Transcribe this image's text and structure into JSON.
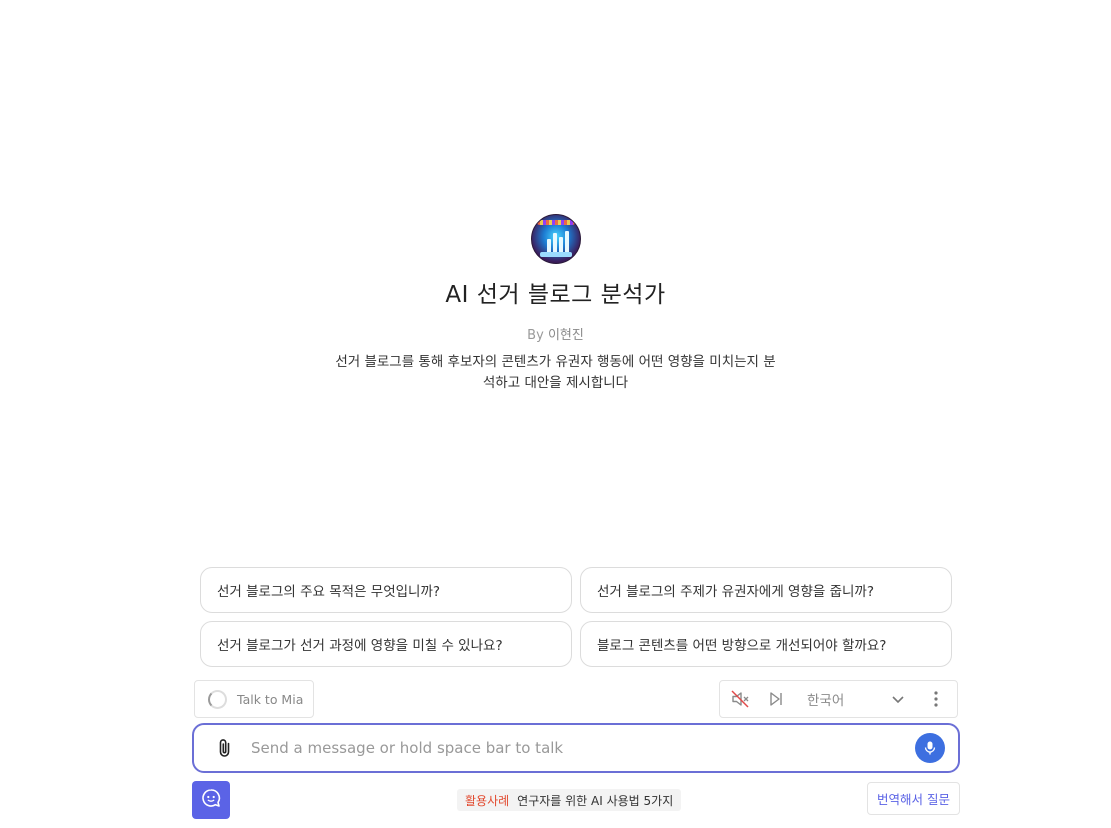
{
  "bot": {
    "name": "AI 선거 블로그 분석가",
    "by_label": "By",
    "author": "이현진",
    "description": "선거 블로그를 통해 후보자의 콘텐츠가 유권자 행동에 어떤 영향을 미치는지 분석하고 대안을 제시합니다"
  },
  "suggestions": [
    "선거 블로그의 주요 목적은 무엇입니까?",
    "선거 블로그의 주제가 유권자에게 영향을 줍니까?",
    "선거 블로그가 선거 과정에 영향을 미칠 수 있나요?",
    "블로그 콘텐츠를 어떤 방향으로 개선되어야 할까요?"
  ],
  "voice": {
    "talk_label": "Talk to Mia",
    "language": "한국어"
  },
  "composer": {
    "placeholder": "Send a message or hold space bar to talk",
    "value": ""
  },
  "footer": {
    "banner_tag": "활용사례",
    "banner_text": "연구자를 위한 AI 사용법 5가지",
    "translate_label": "번역해서 질문"
  },
  "colors": {
    "accent": "#5b63e6",
    "mic": "#3d6fe0",
    "banner_tag": "#e24a2f",
    "composer_border": "#6b6fd6"
  },
  "icons": [
    "bot-avatar",
    "spinner-icon",
    "speaker-muted-icon",
    "skip-icon",
    "chevron-down-icon",
    "more-vertical-icon",
    "paperclip-icon",
    "microphone-icon",
    "chat-bot-icon"
  ]
}
